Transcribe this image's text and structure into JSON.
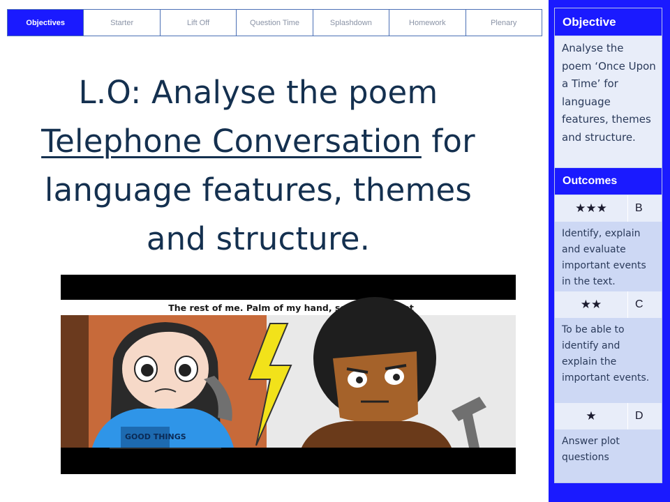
{
  "nav": {
    "tabs": [
      "Objectives",
      "Starter",
      "Lift Off",
      "Question Time",
      "Splashdown",
      "Homework",
      "Plenary"
    ],
    "active_index": 0
  },
  "lo": {
    "prefix": "L.O: Analyse the poem",
    "underlined": "Telephone Conversation",
    "suffix": "for language features, themes and structure."
  },
  "video": {
    "caption": "The rest of me. Palm of my hand, soles of my feet",
    "shirt_text": "GOOD THINGS"
  },
  "panel": {
    "objective_header": "Objective",
    "objective_text": "Analyse the poem ‘Once Upon a Time’ for language features, themes and structure.",
    "outcomes_header": "Outcomes",
    "outcomes": [
      {
        "stars": "★★★",
        "grade": "B",
        "text": "Identify, explain and evaluate important events in the text."
      },
      {
        "stars": "★★",
        "grade": "C",
        "text": "To be able to identify and explain the important events."
      },
      {
        "stars": "★",
        "grade": "D",
        "text": "Answer plot questions"
      }
    ]
  },
  "colors": {
    "accent": "#1a1aff",
    "title_text": "#14304f",
    "panel_bg": "#cdd8f4"
  }
}
